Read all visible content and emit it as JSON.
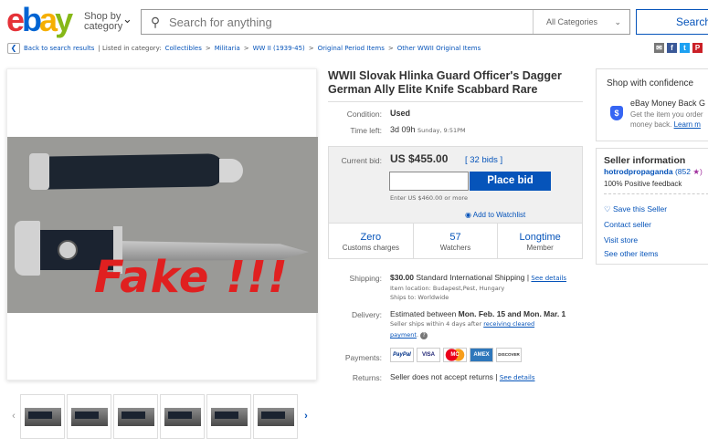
{
  "header": {
    "logo": {
      "e": "e",
      "b": "b",
      "a": "a",
      "y": "y"
    },
    "shop_by_line1": "Shop by",
    "shop_by_line2": "category",
    "search_placeholder": "Search for anything",
    "category_select": "All Categories",
    "search_button": "Search"
  },
  "breadcrumb": {
    "back": "Back to search results",
    "listed": "| Listed in category:",
    "items": [
      "Collectibles",
      "Militaria",
      "WW II (1939-45)",
      "Original Period Items",
      "Other WWII Original Items"
    ],
    "sep": ">"
  },
  "share": {
    "email": "✉",
    "facebook": "f",
    "twitter": "t",
    "pinterest": "P"
  },
  "image": {
    "overlay": "Fake !!!"
  },
  "thumbnails": {
    "count": 6,
    "prev": "‹",
    "next": "›"
  },
  "listing": {
    "title": "WWII Slovak Hlinka Guard Officer's Dagger German Ally Elite Knife Scabbard Rare",
    "condition_label": "Condition:",
    "condition": "Used",
    "time_left_label": "Time left:",
    "time_left": "3d 09h",
    "time_left_detail": "Sunday, 9:51PM",
    "current_bid_label": "Current bid:",
    "current_bid": "US $455.00",
    "bids": "[ 32 bids ]",
    "place_bid": "Place bid",
    "enter_hint": "Enter US $460.00 or more",
    "add_watchlist": "Add to Watchlist",
    "stats": [
      {
        "big": "Zero",
        "sub": "Customs charges"
      },
      {
        "big": "57",
        "sub": "Watchers"
      },
      {
        "big": "Longtime",
        "sub": "Member"
      }
    ],
    "shipping_label": "Shipping:",
    "shipping_price": "$30.00",
    "shipping_text": "Standard International Shipping |",
    "see_details": "See details",
    "item_location": "Item location:  Budapest,Pest, Hungary",
    "ships_to": "Ships to:  Worldwide",
    "delivery_label": "Delivery:",
    "delivery_pre": "Estimated between",
    "delivery_dates": "Mon. Feb. 15 and Mon. Mar. 1",
    "delivery_note": "Seller ships within 4 days after",
    "delivery_link": "receiving cleared",
    "delivery_link2": "payment",
    "payments_label": "Payments:",
    "payments": [
      "PayPal",
      "VISA",
      "MC",
      "AMEX",
      "DISCOVER"
    ],
    "returns_label": "Returns:",
    "returns_text": "Seller does not accept returns |",
    "returns_link": "See details"
  },
  "confidence": {
    "heading": "Shop with confidence",
    "title": "eBay Money Back G",
    "desc1": "Get the item you order",
    "desc2": "money back.",
    "learn": "Learn m"
  },
  "seller": {
    "heading": "Seller information",
    "name": "hotrodpropaganda",
    "score": "(852",
    "star": "★)",
    "feedback": "100% Positive feedback",
    "save": "Save this Seller",
    "contact": "Contact seller",
    "store": "Visit store",
    "other": "See other items"
  },
  "colors": {
    "accent": "#0654ba",
    "fake": "#e02020"
  }
}
